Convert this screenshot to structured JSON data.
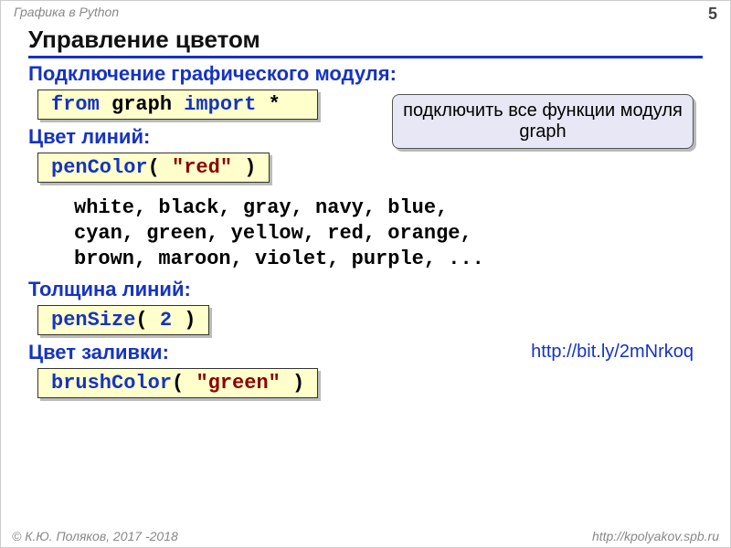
{
  "header": {
    "topic": "Графика в Python",
    "page": "5"
  },
  "title": "Управление цветом",
  "sections": {
    "s1": {
      "label": "Подключение графического модуля:",
      "code": {
        "from": "from",
        "mod": " graph ",
        "import": "import",
        "rest": " *  "
      }
    },
    "s2": {
      "label": "Цвет линий:",
      "code": {
        "fn": "penColor",
        "paren1": "( ",
        "arg": "\"red\"",
        "paren2": " )"
      }
    },
    "s3": {
      "label": "Толщина линий:",
      "code": {
        "fn": "penSize",
        "paren1": "( ",
        "arg": "2",
        "paren2": " )"
      }
    },
    "s4": {
      "label": "Цвет заливки:",
      "code": {
        "fn": "brushColor",
        "paren1": "( ",
        "arg": "\"green\"",
        "paren2": " )"
      }
    }
  },
  "callout": "подключить все функции модуля graph",
  "colors_list": "white, black, gray, navy, blue,\ncyan, green, yellow, red, orange,\nbrown, maroon, violet, purple, ...",
  "link": "http://bit.ly/2mNrkoq",
  "footer": {
    "left": "© К.Ю. Поляков, 2017 -2018",
    "right": "http://kpolyakov.spb.ru"
  }
}
